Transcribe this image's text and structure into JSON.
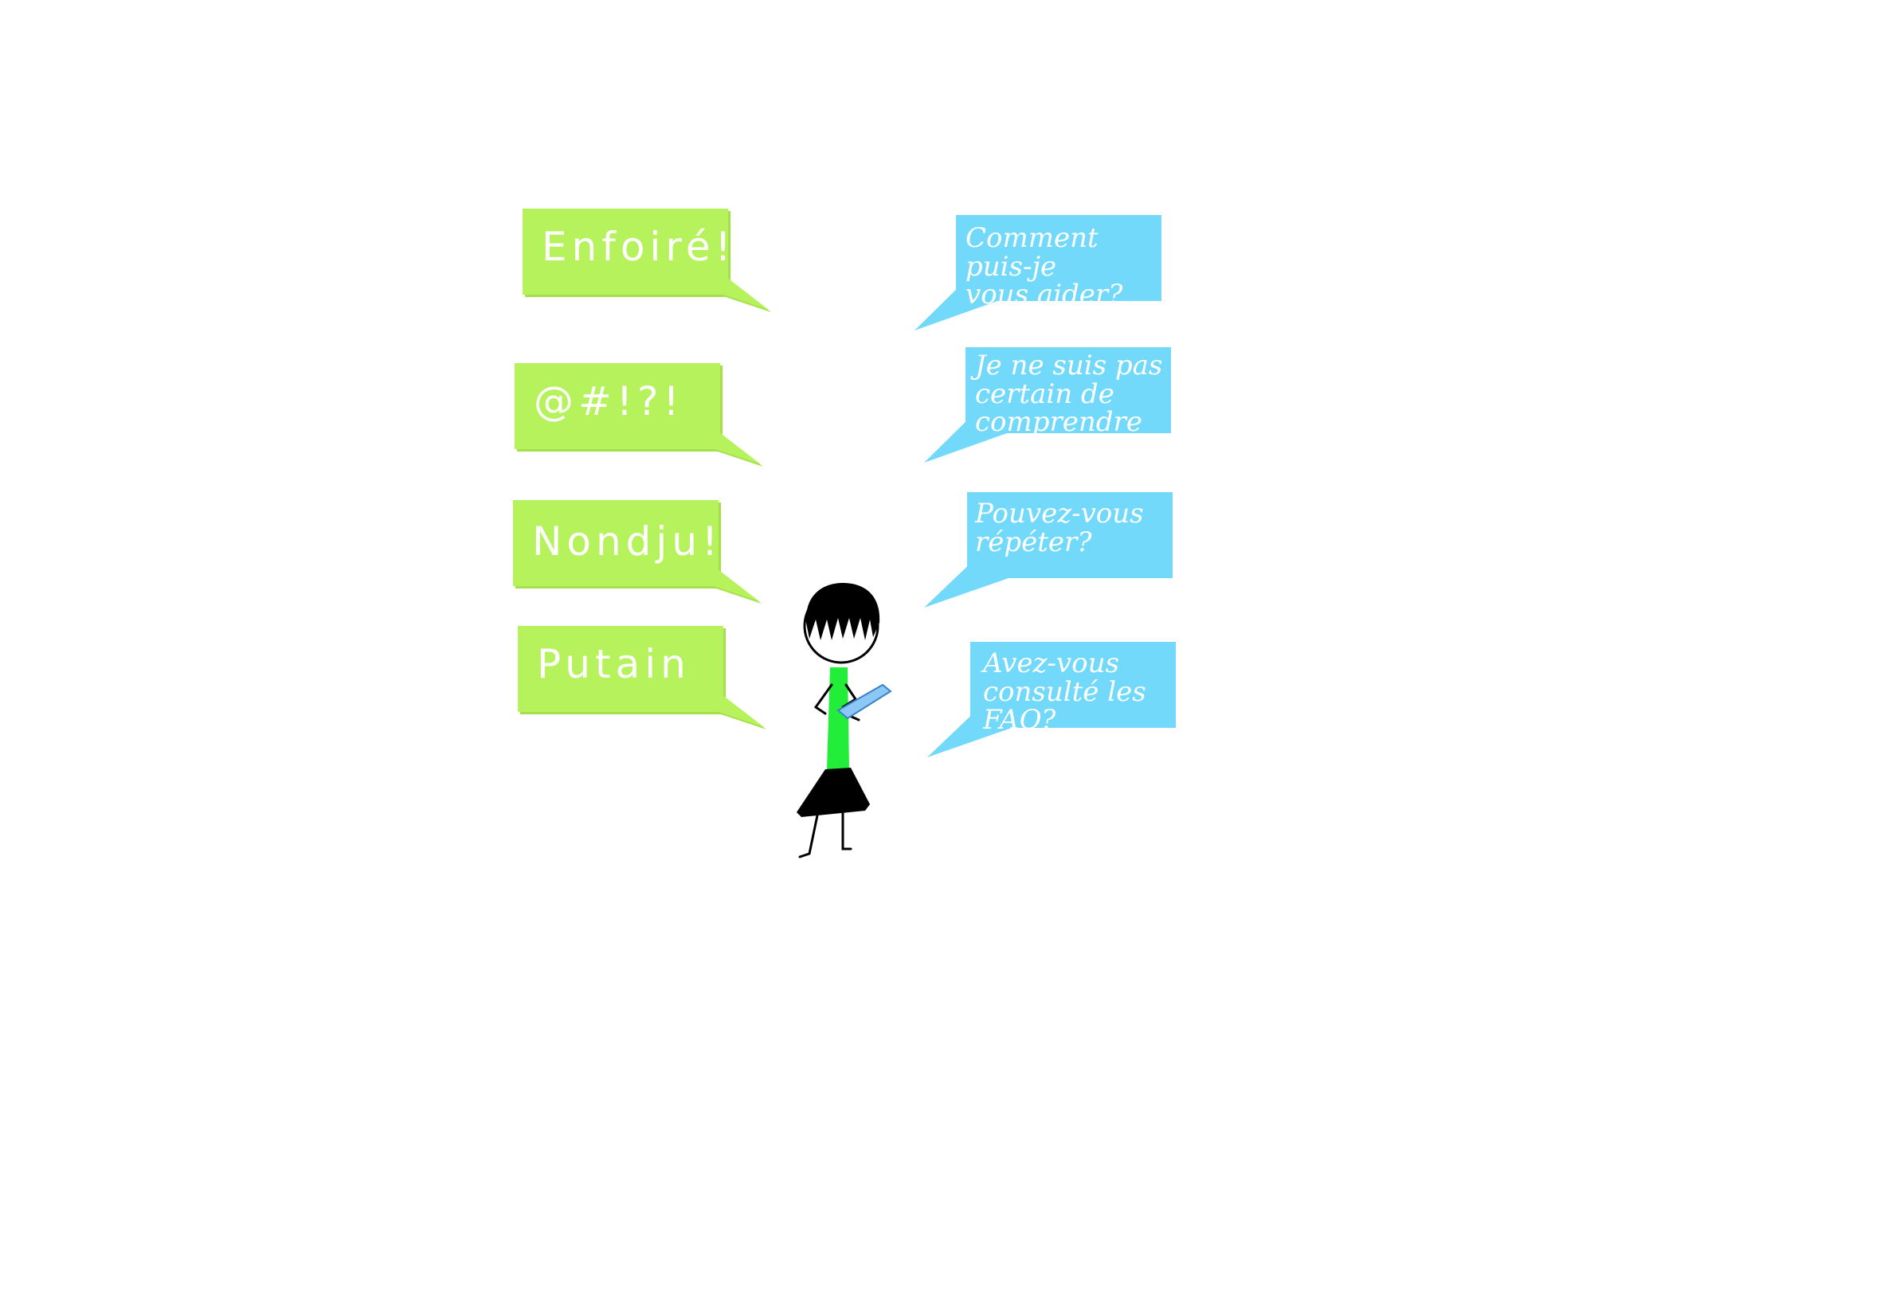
{
  "colors": {
    "insult_bubble": "#b5f25c",
    "insult_bubble_shadow": "#a5e04c",
    "reply_bubble": "#72d9fa",
    "reply_bubble_shadow": "#63c8ea",
    "bubble_text": "#ffffff",
    "shirt": "#22ee3a",
    "skirt_and_hair": "#000000",
    "tablet": "#8cc8f5"
  },
  "insults": [
    "Enfoiré!",
    "@#!?!",
    "Nondju!",
    "Putain"
  ],
  "replies": [
    "Comment puis-je\nvous aider?",
    "Je ne suis pas\ncertain de\ncomprendre",
    "Pouvez-vous\nrépéter?",
    "Avez-vous\nconsulté les FAQ?"
  ],
  "figure": {
    "icon": "person-with-tablet-icon"
  }
}
